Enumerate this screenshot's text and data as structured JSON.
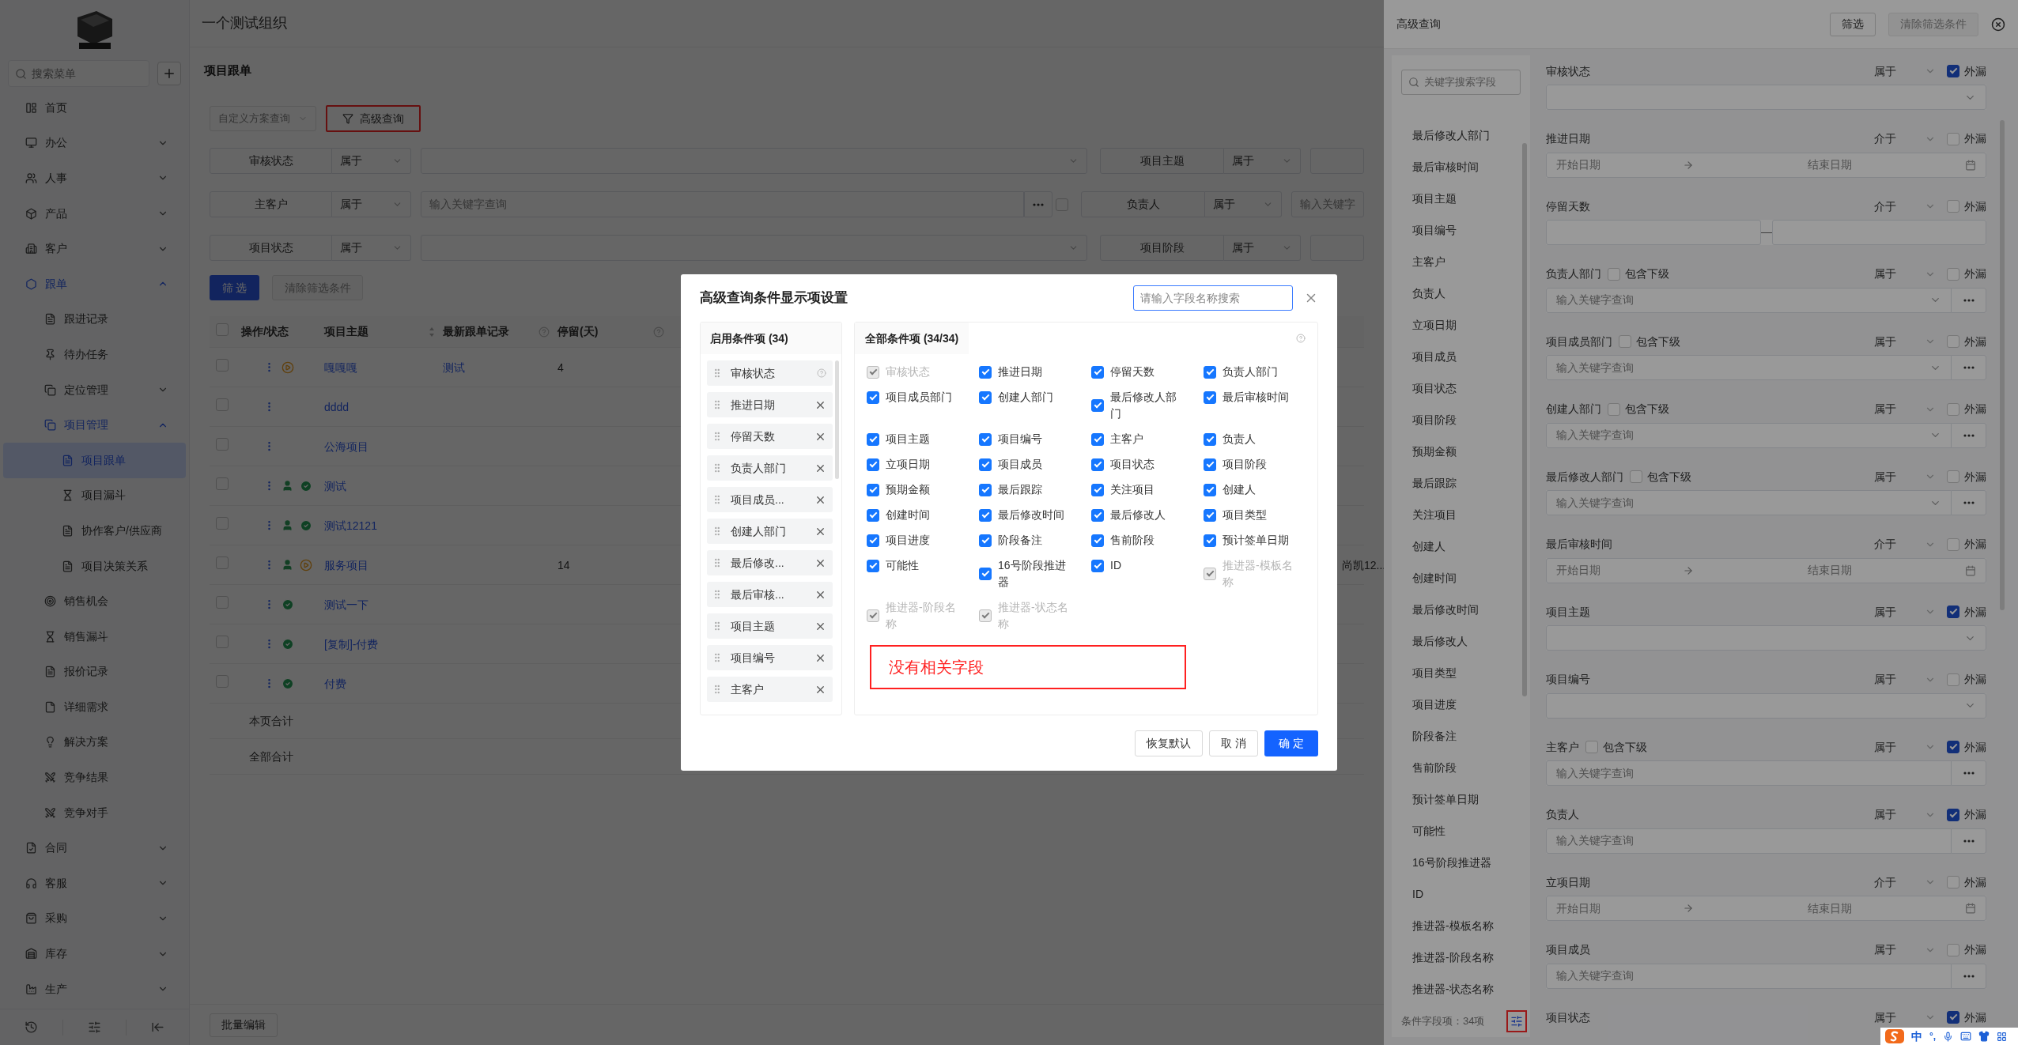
{
  "sidebar": {
    "search": {
      "placeholder": "搜索菜单"
    },
    "items": [
      {
        "label": "首页",
        "selected": false
      },
      {
        "label": "办公",
        "selected": false,
        "expanded": false
      },
      {
        "label": "人事",
        "selected": false,
        "expanded": false
      },
      {
        "label": "产品",
        "selected": false,
        "expanded": false
      },
      {
        "label": "客户",
        "selected": false,
        "expanded": false
      },
      {
        "label": "跟单",
        "selected": false,
        "expanded": true,
        "children": [
          {
            "label": "跟进记录",
            "selected": false
          },
          {
            "label": "待办任务",
            "selected": false
          },
          {
            "label": "定位管理",
            "selected": false,
            "expanded": false
          },
          {
            "label": "项目管理",
            "selected": false,
            "expanded": true,
            "children": [
              {
                "label": "项目跟单",
                "selected": true
              },
              {
                "label": "项目漏斗",
                "selected": false
              },
              {
                "label": "协作客户/供应商",
                "selected": false
              },
              {
                "label": "项目决策关系",
                "selected": false
              }
            ]
          },
          {
            "label": "销售机会",
            "selected": false
          },
          {
            "label": "销售漏斗",
            "selected": false
          },
          {
            "label": "报价记录",
            "selected": false
          },
          {
            "label": "详细需求",
            "selected": false
          },
          {
            "label": "解决方案",
            "selected": false
          },
          {
            "label": "竞争结果",
            "selected": false
          },
          {
            "label": "竞争对手",
            "selected": false
          }
        ]
      },
      {
        "label": "合同",
        "selected": false,
        "expanded": false
      },
      {
        "label": "客服",
        "selected": false,
        "expanded": false
      },
      {
        "label": "采购",
        "selected": false,
        "expanded": false
      },
      {
        "label": "库存",
        "selected": false,
        "expanded": false
      },
      {
        "label": "生产",
        "selected": false,
        "expanded": false
      }
    ]
  },
  "page": {
    "org_title": "一个测试组织",
    "title": "项目跟单"
  },
  "toolbar": {
    "scheme_select": {
      "placeholder": "自定义方案查询"
    },
    "advanced_button": "高级查询"
  },
  "filters": [
    [
      {
        "label": "审核状态",
        "operator": "属于",
        "kind": "select"
      },
      {
        "label": "项目主题",
        "operator": "属于",
        "kind": "select"
      }
    ],
    [
      {
        "label": "主客户",
        "operator": "属于",
        "kind": "keyword",
        "placeholder": "输入关键字查询",
        "checked": false
      },
      {
        "label": "负责人",
        "operator": "属于",
        "kind": "text",
        "placeholder": "输入关键字"
      }
    ],
    [
      {
        "label": "项目状态",
        "operator": "属于",
        "kind": "select"
      },
      {
        "label": "项目阶段",
        "operator": "属于",
        "kind": "select"
      }
    ]
  ],
  "filter_buttons": [
    {
      "label": "筛 选",
      "kind": "primary"
    },
    {
      "label": "清除筛选条件",
      "kind": "disabled"
    }
  ],
  "table": {
    "all_checked": false,
    "columns": [
      {
        "label": "操作/状态"
      },
      {
        "label": "项目主题",
        "sortable": true
      },
      {
        "label": "最新跟单记录",
        "help": true
      },
      {
        "label": "停留(天)",
        "help": true
      }
    ],
    "rows": [
      {
        "checked": false,
        "status_icons": [
          {
            "kind": "pending"
          }
        ],
        "subject": "嘎嘎嘎",
        "latest_record": "测试",
        "stay_days": "4"
      },
      {
        "checked": false,
        "subject": "dddd"
      },
      {
        "checked": false,
        "subject": "公海项目"
      },
      {
        "checked": false,
        "status_icons": [
          {
            "kind": "person"
          },
          {
            "kind": "check"
          }
        ],
        "subject": "测试"
      },
      {
        "checked": false,
        "status_icons": [
          {
            "kind": "person"
          },
          {
            "kind": "check"
          }
        ],
        "subject": "测试12121"
      },
      {
        "checked": false,
        "status_icons": [
          {
            "kind": "person"
          },
          {
            "kind": "pending"
          }
        ],
        "subject": "服务项目",
        "stay_days": "14",
        "column_6": "尚凯12..."
      },
      {
        "checked": false,
        "status_icons": [
          {
            "kind": "check"
          }
        ],
        "subject": "测试一下"
      },
      {
        "checked": false,
        "status_icons": [
          {
            "kind": "check"
          }
        ],
        "subject": "[复制]-付费"
      },
      {
        "checked": false,
        "status_icons": [
          {
            "kind": "check"
          }
        ],
        "subject": "付费"
      }
    ],
    "totals": [
      "本页合计",
      "全部合计"
    ]
  },
  "batch_button": "批量编辑",
  "drawer": {
    "title": "高级查询",
    "buttons": [
      {
        "label": "筛选",
        "disabled": false
      },
      {
        "label": "清除筛选条件",
        "disabled": true
      }
    ],
    "field_search": {
      "placeholder": "关键字搜索字段"
    },
    "fields": [
      "最后修改人部门",
      "最后审核时间",
      "项目主题",
      "项目编号",
      "主客户",
      "负责人",
      "立项日期",
      "项目成员",
      "项目状态",
      "项目阶段",
      "预期金额",
      "最后跟踪",
      "关注项目",
      "创建人",
      "创建时间",
      "最后修改时间",
      "最后修改人",
      "项目类型",
      "项目进度",
      "阶段备注",
      "售前阶段",
      "预计签单日期",
      "可能性",
      "16号阶段推进器",
      "ID",
      "推进器-模板名称",
      "推进器-阶段名称",
      "推进器-状态名称"
    ],
    "field_count": "条件字段项：34项",
    "conditions": [
      {
        "label": "审核状态",
        "operator": "属于",
        "leak_label": "外漏",
        "leak_checked": true,
        "kind": "select"
      },
      {
        "label": "推进日期",
        "operator": "介于",
        "leak_label": "外漏",
        "leak_checked": false,
        "kind": "daterange",
        "start_placeholder": "开始日期",
        "end_placeholder": "结束日期"
      },
      {
        "label": "停留天数",
        "operator": "介于",
        "leak_label": "外漏",
        "leak_checked": false,
        "kind": "numrange"
      },
      {
        "label": "负责人部门",
        "include_sub_label": "包含下级",
        "include_sub": false,
        "operator": "属于",
        "leak_label": "外漏",
        "leak_checked": false,
        "kind": "keyword_select",
        "placeholder": "输入关键字查询"
      },
      {
        "label": "项目成员部门",
        "include_sub_label": "包含下级",
        "include_sub": false,
        "operator": "属于",
        "leak_label": "外漏",
        "leak_checked": false,
        "kind": "keyword_select",
        "placeholder": "输入关键字查询"
      },
      {
        "label": "创建人部门",
        "include_sub_label": "包含下级",
        "include_sub": false,
        "operator": "属于",
        "leak_label": "外漏",
        "leak_checked": false,
        "kind": "keyword_select",
        "placeholder": "输入关键字查询"
      },
      {
        "label": "最后修改人部门",
        "include_sub_label": "包含下级",
        "include_sub": false,
        "operator": "属于",
        "leak_label": "外漏",
        "leak_checked": false,
        "kind": "keyword_select",
        "placeholder": "输入关键字查询"
      },
      {
        "label": "最后审核时间",
        "operator": "介于",
        "leak_label": "外漏",
        "leak_checked": false,
        "kind": "daterange",
        "start_placeholder": "开始日期",
        "end_placeholder": "结束日期"
      },
      {
        "label": "项目主题",
        "operator": "属于",
        "leak_label": "外漏",
        "leak_checked": true,
        "kind": "select"
      },
      {
        "label": "项目编号",
        "operator": "属于",
        "leak_label": "外漏",
        "leak_checked": false,
        "kind": "select"
      },
      {
        "label": "主客户",
        "include_sub_label": "包含下级",
        "include_sub": false,
        "operator": "属于",
        "leak_label": "外漏",
        "leak_checked": true,
        "kind": "keyword",
        "placeholder": "输入关键字查询"
      },
      {
        "label": "负责人",
        "operator": "属于",
        "leak_label": "外漏",
        "leak_checked": true,
        "kind": "keyword",
        "placeholder": "输入关键字查询"
      },
      {
        "label": "立项日期",
        "operator": "介于",
        "leak_label": "外漏",
        "leak_checked": false,
        "kind": "daterange",
        "start_placeholder": "开始日期",
        "end_placeholder": "结束日期"
      },
      {
        "label": "项目成员",
        "operator": "属于",
        "leak_label": "外漏",
        "leak_checked": false,
        "kind": "keyword",
        "placeholder": "输入关键字查询"
      },
      {
        "label": "项目状态",
        "operator": "属于",
        "leak_label": "外漏",
        "leak_checked": true
      }
    ]
  },
  "modal": {
    "title": "高级查询条件显示项设置",
    "search": {
      "placeholder": "请输入字段名称搜索"
    },
    "enabled_panel": {
      "title": "启用条件项 (34)",
      "items": [
        {
          "label": "审核状态",
          "removable": false
        },
        {
          "label": "推进日期",
          "removable": true
        },
        {
          "label": "停留天数",
          "removable": true
        },
        {
          "label": "负责人部门",
          "removable": true
        },
        {
          "label": "项目成员...",
          "removable": true
        },
        {
          "label": "创建人部门",
          "removable": true
        },
        {
          "label": "最后修改...",
          "removable": true
        },
        {
          "label": "最后审核...",
          "removable": true
        },
        {
          "label": "项目主题",
          "removable": true
        },
        {
          "label": "项目编号",
          "removable": true
        },
        {
          "label": "主客户",
          "removable": true
        }
      ]
    },
    "all_panel": {
      "title": "全部条件项 (34/34)",
      "items": [
        {
          "label": "审核状态",
          "checked": true,
          "disabled": true
        },
        {
          "label": "推进日期",
          "checked": true,
          "disabled": false
        },
        {
          "label": "停留天数",
          "checked": true,
          "disabled": false
        },
        {
          "label": "负责人部门",
          "checked": true,
          "disabled": false
        },
        {
          "label": "项目成员部门",
          "checked": true,
          "disabled": false
        },
        {
          "label": "创建人部门",
          "checked": true,
          "disabled": false
        },
        {
          "label": "最后修改人部门",
          "checked": true,
          "disabled": false
        },
        {
          "label": "最后审核时间",
          "checked": true,
          "disabled": false
        },
        {
          "label": "项目主题",
          "checked": true,
          "disabled": false
        },
        {
          "label": "项目编号",
          "checked": true,
          "disabled": false
        },
        {
          "label": "主客户",
          "checked": true,
          "disabled": false
        },
        {
          "label": "负责人",
          "checked": true,
          "disabled": false
        },
        {
          "label": "立项日期",
          "checked": true,
          "disabled": false
        },
        {
          "label": "项目成员",
          "checked": true,
          "disabled": false
        },
        {
          "label": "项目状态",
          "checked": true,
          "disabled": false
        },
        {
          "label": "项目阶段",
          "checked": true,
          "disabled": false
        },
        {
          "label": "预期金额",
          "checked": true,
          "disabled": false
        },
        {
          "label": "最后跟踪",
          "checked": true,
          "disabled": false
        },
        {
          "label": "关注项目",
          "checked": true,
          "disabled": false
        },
        {
          "label": "创建人",
          "checked": true,
          "disabled": false
        },
        {
          "label": "创建时间",
          "checked": true,
          "disabled": false
        },
        {
          "label": "最后修改时间",
          "checked": true,
          "disabled": false
        },
        {
          "label": "最后修改人",
          "checked": true,
          "disabled": false
        },
        {
          "label": "项目类型",
          "checked": true,
          "disabled": false
        },
        {
          "label": "项目进度",
          "checked": true,
          "disabled": false
        },
        {
          "label": "阶段备注",
          "checked": true,
          "disabled": false
        },
        {
          "label": "售前阶段",
          "checked": true,
          "disabled": false
        },
        {
          "label": "预计签单日期",
          "checked": true,
          "disabled": false
        },
        {
          "label": "可能性",
          "checked": true,
          "disabled": false
        },
        {
          "label": "16号阶段推进器",
          "checked": true,
          "disabled": false
        },
        {
          "label": "ID",
          "checked": true,
          "disabled": false
        },
        {
          "label": "推进器-模板名称",
          "checked": true,
          "disabled": true
        },
        {
          "label": "推进器-阶段名称",
          "checked": true,
          "disabled": true
        },
        {
          "label": "推进器-状态名称",
          "checked": true,
          "disabled": true
        }
      ]
    },
    "empty_message": "没有相关字段",
    "buttons": [
      {
        "label": "恢复默认",
        "kind": "default"
      },
      {
        "label": "取 消",
        "kind": "default"
      },
      {
        "label": "确 定",
        "kind": "primary"
      }
    ]
  },
  "ime_bar": {
    "mode": "中",
    "punct": "°,"
  }
}
